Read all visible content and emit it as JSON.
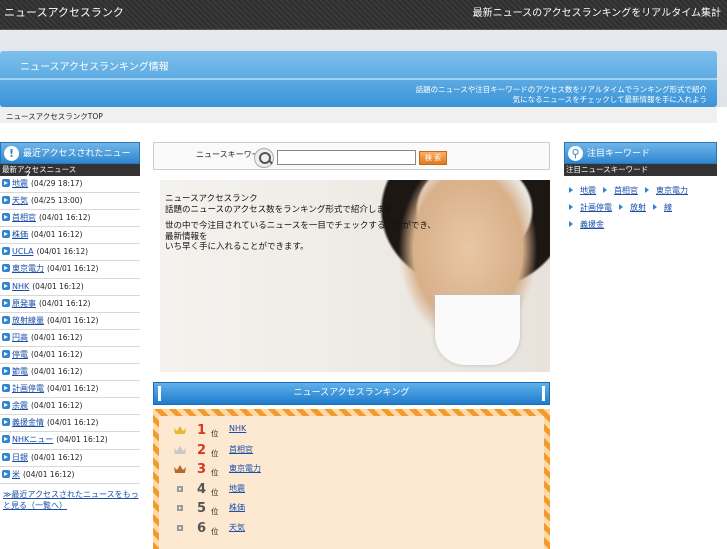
{
  "header": {
    "site_name": "ニュースアクセスランク",
    "tagline": "最新ニュースのアクセスランキングをリアルタイム集計"
  },
  "banner": {
    "title": "ニュースアクセスランキング情報",
    "description_line1": "話題のニュースや注目キーワードのアクセス数をリアルタイムでランキング形式で紹介",
    "description_line2": "気になるニュースをチェックして最新情報を手に入れよう"
  },
  "breadcrumb": {
    "text": "ニュースアクセスランクTOP"
  },
  "left": {
    "title": "最近アクセスされたニュース",
    "subtitle": "最新アクセスニュース",
    "items": [
      {
        "label": "地震",
        "time": "(04/29 18:17)"
      },
      {
        "label": "天気",
        "time": "(04/25 13:00)"
      },
      {
        "label": "首相官",
        "time": "(04/01 16:12)"
      },
      {
        "label": "株価",
        "time": "(04/01 16:12)"
      },
      {
        "label": "UCLA",
        "time": "(04/01 16:12)"
      },
      {
        "label": "東京電力",
        "time": "(04/01 16:12)"
      },
      {
        "label": "NHK",
        "time": "(04/01 16:12)"
      },
      {
        "label": "原発事",
        "time": "(04/01 16:12)"
      },
      {
        "label": "放射線量",
        "time": "(04/01 16:12)"
      },
      {
        "label": "円高",
        "time": "(04/01 16:12)"
      },
      {
        "label": "停電",
        "time": "(04/01 16:12)"
      },
      {
        "label": "節電",
        "time": "(04/01 16:12)"
      },
      {
        "label": "計画停電",
        "time": "(04/01 16:12)"
      },
      {
        "label": "余震",
        "time": "(04/01 16:12)"
      },
      {
        "label": "義援金情",
        "time": "(04/01 16:12)"
      },
      {
        "label": "NHKニュー",
        "time": "(04/01 16:12)"
      },
      {
        "label": "日銀",
        "time": "(04/01 16:12)"
      },
      {
        "label": "米",
        "time": "(04/01 16:12)"
      }
    ],
    "more": "≫最近アクセスされたニュースをもっと見る（一覧へ）"
  },
  "search": {
    "label": "ニュースキーワード",
    "value": "",
    "placeholder": "",
    "button": "検 索"
  },
  "hero": {
    "heading": "ニュースアクセスランク",
    "line1": "話題のニュースのアクセス数をランキング形式で紹介します",
    "line2": "世の中で今注目されているニュースを一目でチェックすることができ、",
    "line3": "最新情報を",
    "line4": "いち早く手に入れることができます。"
  },
  "ranking": {
    "title": "ニュースアクセスランキング",
    "rows": [
      {
        "rank": "1",
        "unit": "位",
        "label": "NHK",
        "color": "#d23a1e"
      },
      {
        "rank": "2",
        "unit": "位",
        "label": "首相官",
        "color": "#d23a1e"
      },
      {
        "rank": "3",
        "unit": "位",
        "label": "東京電力",
        "color": "#d23a1e"
      },
      {
        "rank": "4",
        "unit": "位",
        "label": "地震",
        "color": "#555555"
      },
      {
        "rank": "5",
        "unit": "位",
        "label": "株価",
        "color": "#555555"
      },
      {
        "rank": "6",
        "unit": "位",
        "label": "天気",
        "color": "#555555"
      }
    ]
  },
  "right": {
    "title": "注目キーワード",
    "subtitle": "注目ニュースキーワード",
    "tags": [
      "地震",
      "首相官",
      "東京電力",
      "計画停電",
      "放射",
      "線",
      "義援金"
    ]
  }
}
